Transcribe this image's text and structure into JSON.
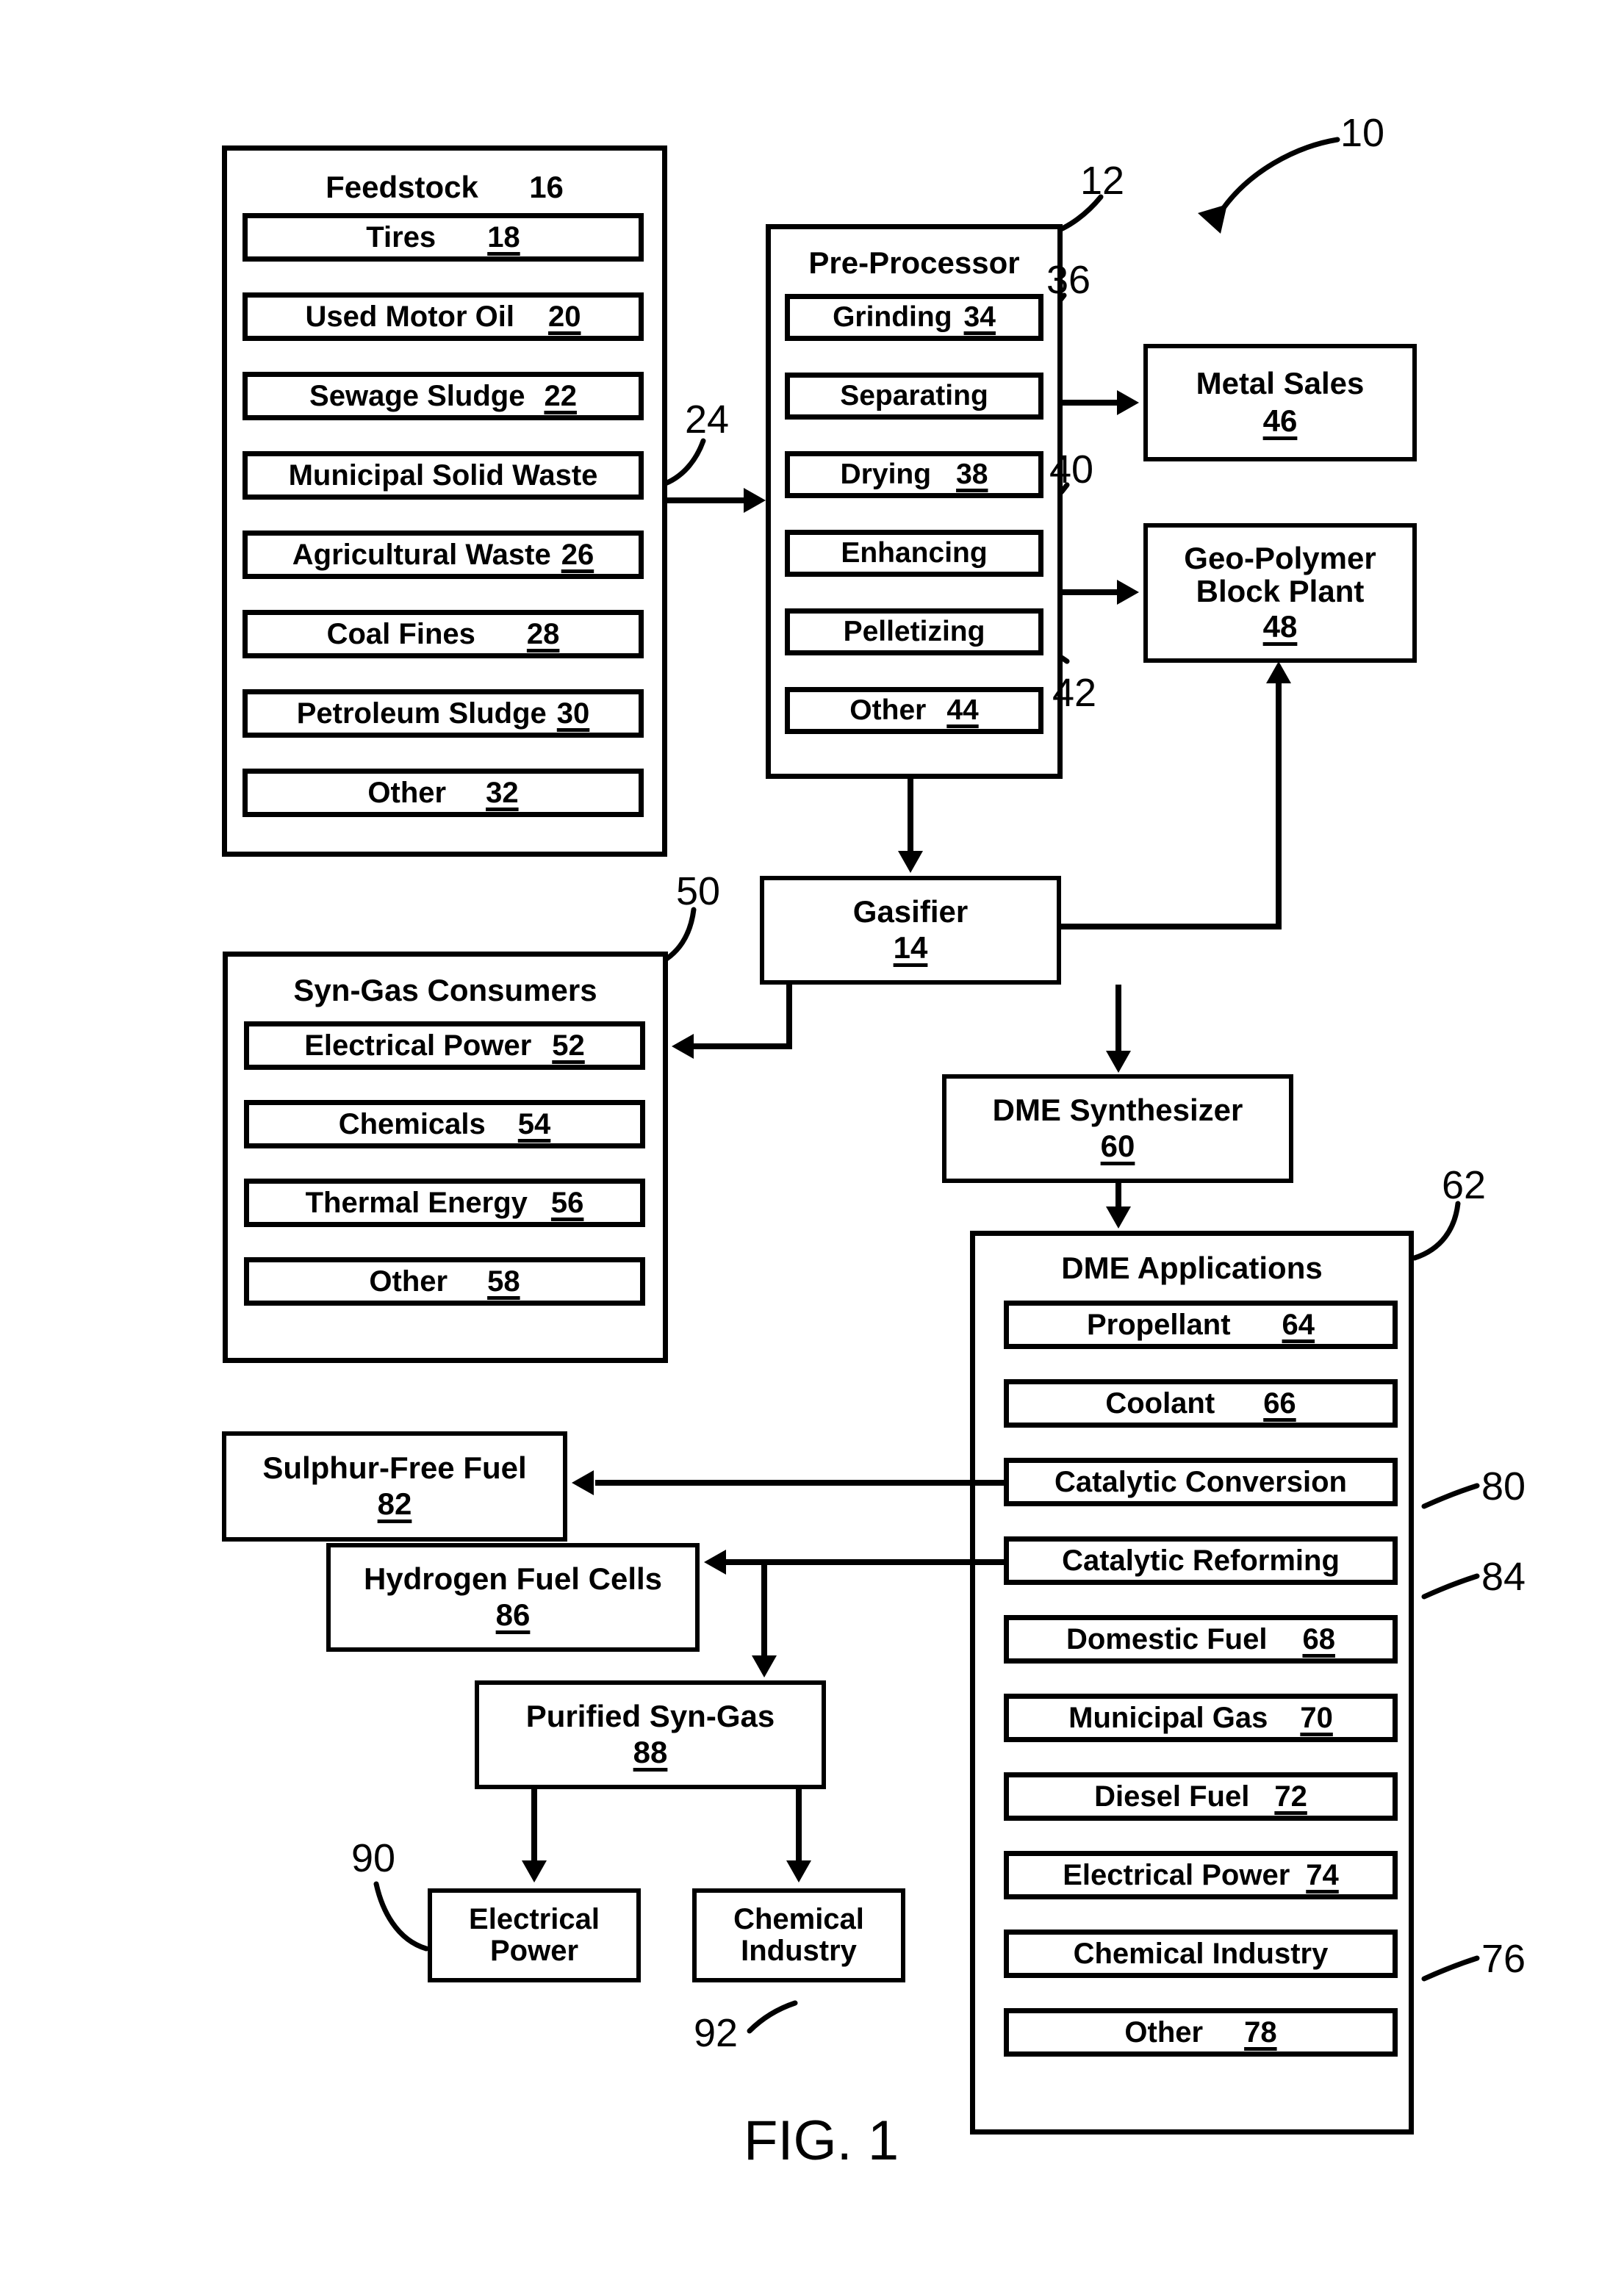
{
  "figure": {
    "caption": "FIG. 1",
    "system_ref": "10"
  },
  "feedstock": {
    "title": "Feedstock",
    "ref": "16",
    "items": [
      {
        "label": "Tires",
        "ref": "18"
      },
      {
        "label": "Used Motor Oil",
        "ref": "20"
      },
      {
        "label": "Sewage Sludge",
        "ref": "22"
      },
      {
        "label": "Municipal Solid Waste",
        "ref": ""
      },
      {
        "label": "Agricultural Waste",
        "ref": "26"
      },
      {
        "label": "Coal Fines",
        "ref": "28"
      },
      {
        "label": "Petroleum Sludge",
        "ref": "30"
      },
      {
        "label": "Other",
        "ref": "32"
      }
    ],
    "output_flow_ref": "24"
  },
  "preprocessor": {
    "title": "Pre-Processor",
    "ref": "12",
    "items": [
      {
        "label": "Grinding",
        "ref": "34"
      },
      {
        "label": "Separating",
        "ref": ""
      },
      {
        "label": "Drying",
        "ref": "38"
      },
      {
        "label": "Enhancing",
        "ref": ""
      },
      {
        "label": "Pelletizing",
        "ref": ""
      },
      {
        "label": "Other",
        "ref": "44"
      }
    ],
    "separating_flow_ref": "36",
    "enhancing_flow_ref": "40",
    "pelletizing_flow_ref": "42"
  },
  "metal_sales": {
    "label": "Metal Sales",
    "ref": "46"
  },
  "geo_polymer": {
    "label": "Geo-Polymer\nBlock Plant",
    "ref": "48"
  },
  "gasifier": {
    "label": "Gasifier",
    "ref": "14"
  },
  "syngas_consumers": {
    "title": "Syn-Gas Consumers",
    "ref": "50",
    "items": [
      {
        "label": "Electrical Power",
        "ref": "52"
      },
      {
        "label": "Chemicals",
        "ref": "54"
      },
      {
        "label": "Thermal Energy",
        "ref": "56"
      },
      {
        "label": "Other",
        "ref": "58"
      }
    ]
  },
  "dme_synthesizer": {
    "label": "DME Synthesizer",
    "ref": "60"
  },
  "dme_applications": {
    "title": "DME Applications",
    "ref": "62",
    "items": [
      {
        "label": "Propellant",
        "ref": "64"
      },
      {
        "label": "Coolant",
        "ref": "66"
      },
      {
        "label": "Catalytic Conversion",
        "ref": ""
      },
      {
        "label": "Catalytic Reforming",
        "ref": ""
      },
      {
        "label": "Domestic Fuel",
        "ref": "68"
      },
      {
        "label": "Municipal Gas",
        "ref": "70"
      },
      {
        "label": "Diesel Fuel",
        "ref": "72"
      },
      {
        "label": "Electrical Power",
        "ref": "74"
      },
      {
        "label": "Chemical Industry",
        "ref": ""
      },
      {
        "label": "Other",
        "ref": "78"
      }
    ],
    "catalytic_conversion_ref": "80",
    "catalytic_reforming_ref": "84",
    "chemical_industry_ref": "76"
  },
  "sulphur_free_fuel": {
    "label": "Sulphur-Free Fuel",
    "ref": "82"
  },
  "hydrogen_fuel_cells": {
    "label": "Hydrogen Fuel Cells",
    "ref": "86"
  },
  "purified_syngas": {
    "label": "Purified Syn-Gas",
    "ref": "88"
  },
  "electrical_power_out": {
    "label": "Electrical\nPower",
    "ref": "90"
  },
  "chemical_industry_out": {
    "label": "Chemical\nIndustry",
    "ref": "92"
  }
}
